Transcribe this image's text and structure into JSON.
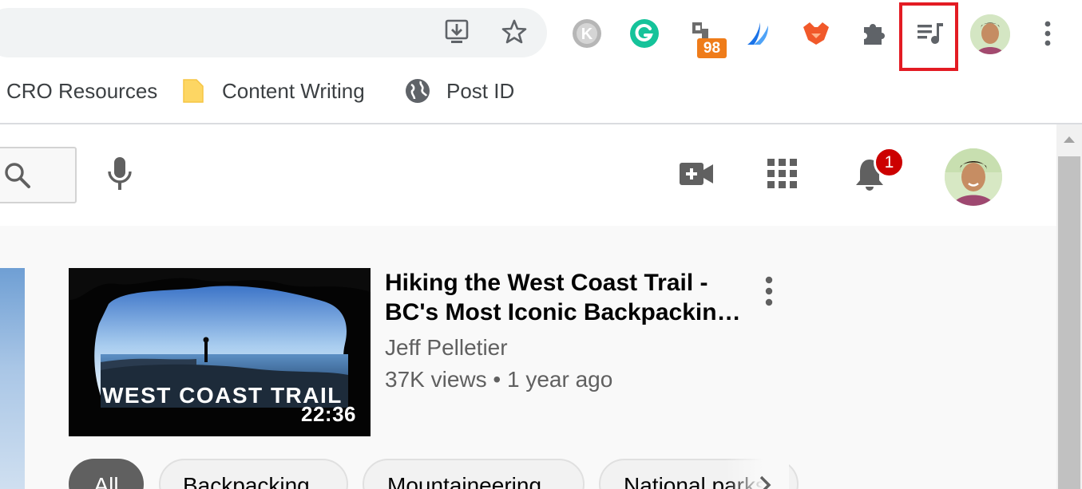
{
  "toolbar": {
    "ext_badge_count": "98",
    "highlight_color": "#e31b23"
  },
  "bookmarks": [
    {
      "label": "CRO Resources"
    },
    {
      "label": "Content Writing"
    },
    {
      "label": "Post ID"
    }
  ],
  "masthead": {
    "notification_count": "1"
  },
  "video": {
    "title_line1": "Hiking the West Coast Trail -",
    "title_line2": "BC's Most Iconic Backpacking…",
    "channel": "Jeff Pelletier",
    "meta": "37K views • 1 year ago",
    "duration": "22:36",
    "thumbnail_text": "WEST COAST TRAIL"
  },
  "chips": [
    {
      "label": "All",
      "active": true
    },
    {
      "label": "Backpacking"
    },
    {
      "label": "Mountaineering"
    },
    {
      "label": "National parks"
    }
  ],
  "colors": {
    "youtube_red": "#cc0000",
    "grammarly_green": "#15c39a",
    "badge_orange": "#ef7c1a"
  }
}
